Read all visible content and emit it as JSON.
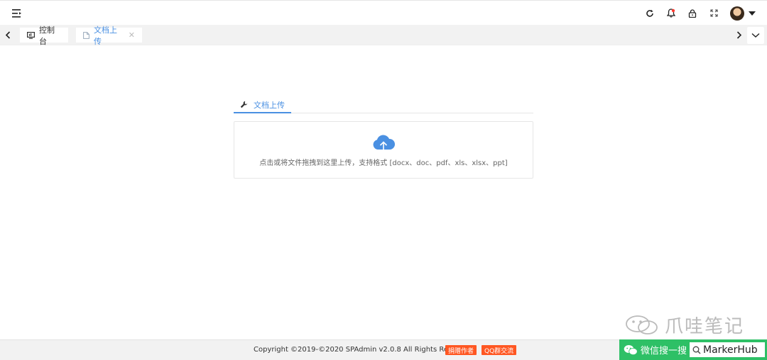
{
  "header": {
    "icons": [
      "menu-icon",
      "refresh-icon",
      "bell-icon",
      "lock-icon",
      "fullscreen-icon",
      "avatar",
      "chevron-down-icon"
    ]
  },
  "tabs": [
    {
      "label": "控制台",
      "icon": "monitor-icon",
      "active": false
    },
    {
      "label": "文档上传",
      "icon": "document-icon",
      "active": true
    }
  ],
  "panel": {
    "tab_label": "文档上传",
    "tab_icon": "wrench-icon",
    "upload_hint": "点击或将文件拖拽到这里上传，支持格式 [docx、doc、pdf、xls、xlsx、ppt]"
  },
  "footer": {
    "copyright": "Copyright ©2019-©2020 SPAdmin v2.0.8 All Rights Reserved",
    "donate_label": "捐赠作者",
    "qq_label": "QQ群交流"
  },
  "watermark": {
    "text": "爪哇笔记",
    "wechat_text": "微信搜一搜",
    "search_value": "MarkerHub"
  },
  "colors": {
    "accent": "#4a90e2",
    "badge": "#ff5722",
    "wechat": "#2ec066"
  }
}
